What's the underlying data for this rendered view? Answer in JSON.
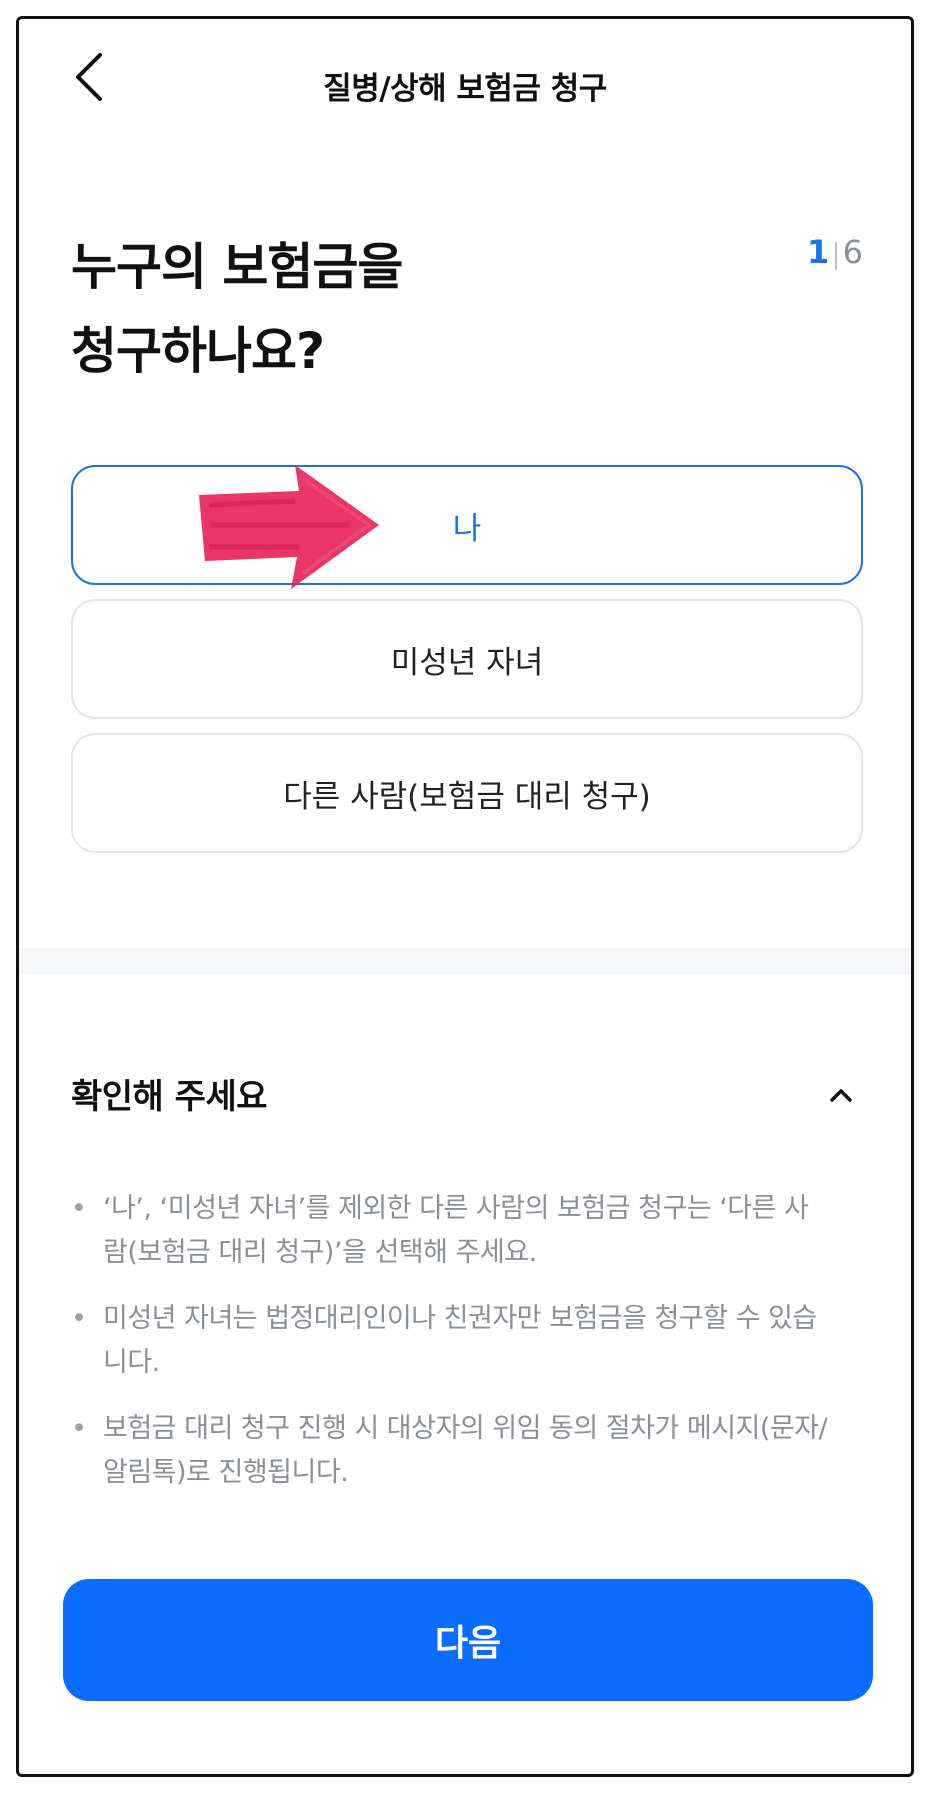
{
  "header": {
    "back_icon": "chevron-left-icon",
    "title": "질병/상해 보험금 청구"
  },
  "question": {
    "line1": "누구의 보험금을",
    "line2": "청구하나요?"
  },
  "step": {
    "current": "1",
    "separator": "|",
    "total": "6"
  },
  "options": [
    {
      "label": "나",
      "selected": true
    },
    {
      "label": "미성년 자녀",
      "selected": false
    },
    {
      "label": "다른 사람(보험금 대리 청구)",
      "selected": false
    }
  ],
  "annotation": {
    "arrow_icon": "red-arrow-annotation",
    "color": "#e8245a"
  },
  "notice": {
    "title": "확인해 주세요",
    "toggle_icon": "chevron-up-icon",
    "bullet": "•",
    "items": [
      "‘나’, ‘미성년 자녀’를 제외한 다른 사람의 보험금 청구는 ‘다른 사람(보험금 대리 청구)’을 선택해 주세요.",
      "미성년 자녀는 법정대리인이나 친권자만 보험금을 청구할 수 있습니다.",
      "보험금 대리 청구 진행 시 대상자의 위임 동의 절차가 메시지(문자/알림톡)로 진행됩니다."
    ]
  },
  "next_button": {
    "label": "다음"
  },
  "colors": {
    "accent": "#1a73e8",
    "primary_button": "#0a6cff",
    "muted_text": "#8b8f96"
  }
}
